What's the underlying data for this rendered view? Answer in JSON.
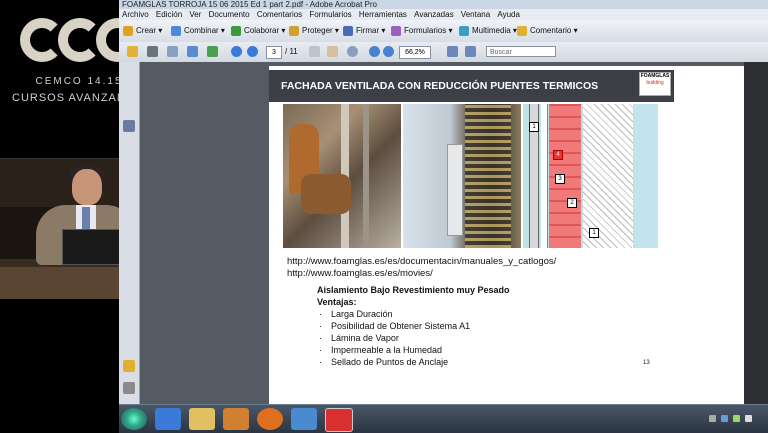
{
  "overlay": {
    "logo_text": "CEMCO 14.15",
    "subtitle": "CURSOS AVANZADOS"
  },
  "window": {
    "title": "FOAMGLAS TORROJA 15 06 2015 Ed 1 part 2.pdf - Adobe Acrobat Pro"
  },
  "menu": [
    "Archivo",
    "Edición",
    "Ver",
    "Documento",
    "Comentarios",
    "Formularios",
    "Herramientas",
    "Avanzadas",
    "Ventana",
    "Ayuda"
  ],
  "tasks": [
    {
      "label": "Crear",
      "icon": "create-icon",
      "color": "#e0a020"
    },
    {
      "label": "Combinar",
      "icon": "combine-icon",
      "color": "#4a8ad8"
    },
    {
      "label": "Colaborar",
      "icon": "collaborate-icon",
      "color": "#3b9a3b"
    },
    {
      "label": "Proteger",
      "icon": "lock-icon",
      "color": "#d0a030"
    },
    {
      "label": "Firmar",
      "icon": "pen-icon",
      "color": "#4a6ab8"
    },
    {
      "label": "Formularios",
      "icon": "forms-icon",
      "color": "#9a60c0"
    },
    {
      "label": "Multimedia",
      "icon": "multimedia-icon",
      "color": "#3aa0c0"
    },
    {
      "label": "Comentario",
      "icon": "comment-icon",
      "color": "#e0b030"
    }
  ],
  "toolbar": {
    "page_current": "3",
    "page_total": "/ 11",
    "zoom": "66,2%",
    "search_placeholder": "Buscar"
  },
  "slide": {
    "title": "FACHADA VENTILADA CON REDUCCIÓN PUENTES TERMICOS",
    "brand_line1": "FOAMGLAS",
    "brand_line2": "building",
    "link1": "http://www.foamglas.es/es/documentacin/manuales_y_catlogos/",
    "link2": "http://www.foamglas.es/es/movies/",
    "heading": "Aislamiento Bajo Revestimiento muy Pesado",
    "subheading": "Ventajas:",
    "bullets": [
      "Larga Duración",
      "Posibilidad de Obtener Sistema A1",
      "Lámina de Vapor",
      "Impermeable a la Humedad",
      "Sellado de Puntos de Anclaje"
    ],
    "page_number": "13",
    "diagram_labels": [
      "1",
      "4",
      "3",
      "2",
      "1"
    ]
  }
}
